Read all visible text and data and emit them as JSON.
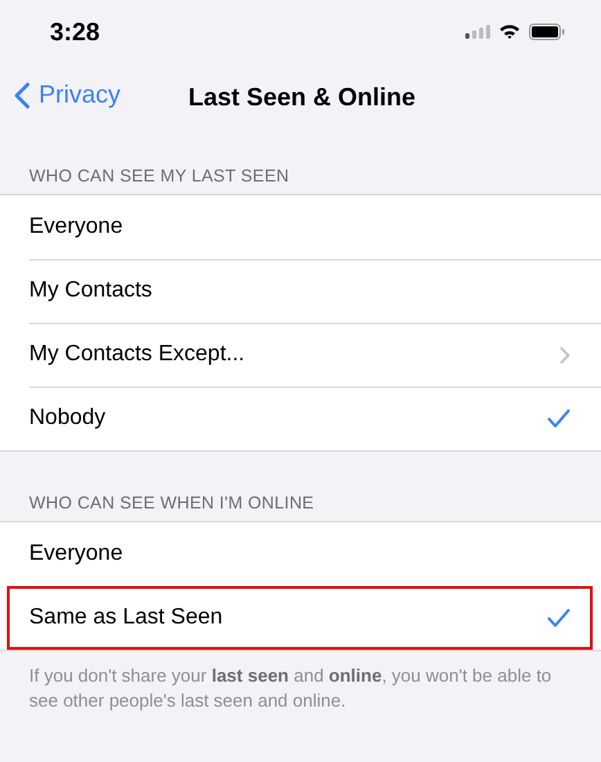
{
  "status_bar": {
    "time": "3:28"
  },
  "nav": {
    "back": "Privacy",
    "title": "Last Seen & Online"
  },
  "sections": [
    {
      "header": "WHO CAN SEE MY LAST SEEN",
      "rows": [
        {
          "label": "Everyone",
          "kind": "option",
          "selected": false,
          "highlighted": false
        },
        {
          "label": "My Contacts",
          "kind": "option",
          "selected": false,
          "highlighted": false
        },
        {
          "label": "My Contacts Except...",
          "kind": "disclosure",
          "highlighted": false
        },
        {
          "label": "Nobody",
          "kind": "option",
          "selected": true,
          "highlighted": false
        }
      ]
    },
    {
      "header": "WHO CAN SEE WHEN I'M ONLINE",
      "rows": [
        {
          "label": "Everyone",
          "kind": "option",
          "selected": false,
          "highlighted": false
        },
        {
          "label": "Same as Last Seen",
          "kind": "option",
          "selected": true,
          "highlighted": true
        }
      ],
      "footer": "If you don't share your **last seen** and **online**, you won't be able to see other people's last seen and online."
    }
  ]
}
